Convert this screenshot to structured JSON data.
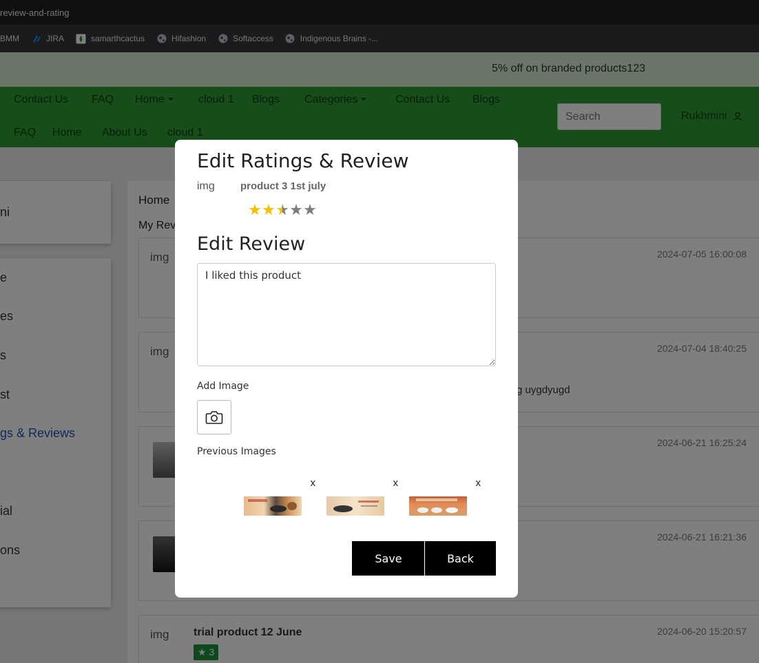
{
  "browser": {
    "tab_title": "review-and-rating",
    "bookmarks": [
      {
        "label": "BMM",
        "icon": "none"
      },
      {
        "label": "JIRA",
        "icon": "jira-icon"
      },
      {
        "label": "samarthcactus",
        "icon": "cactus-icon"
      },
      {
        "label": "Hifashion",
        "icon": "globe-icon"
      },
      {
        "label": "Softaccess",
        "icon": "globe-icon"
      },
      {
        "label": "Indigenous Brains -...",
        "icon": "globe-icon"
      }
    ]
  },
  "promo": {
    "text": "5% off on branded products123"
  },
  "navbar": {
    "row1": [
      "Contact Us",
      "FAQ",
      "Home",
      "cloud 1",
      "Blogs",
      "Categories",
      "Contact Us",
      "Blogs"
    ],
    "row2": [
      "FAQ",
      "Home",
      "About Us",
      "cloud 1"
    ],
    "search_placeholder": "Search",
    "user_name": "Rukhmini"
  },
  "sidebar": {
    "profile_name": "ni",
    "items": [
      "e",
      "es",
      "s",
      "st",
      "gs & Reviews",
      "ial",
      "ons"
    ],
    "active_index": 4
  },
  "main": {
    "breadcrumb": "Home",
    "heading": "My Rev",
    "reviews": [
      {
        "img_alt": "img",
        "date": "2024-07-05 16:00:08",
        "title": "",
        "text": ""
      },
      {
        "img_alt": "img",
        "date": "2024-07-04 18:40:25",
        "title": "",
        "text": "g uygdyugd"
      },
      {
        "img_alt": "",
        "date": "2024-06-21 16:25:24",
        "title": "",
        "text": ""
      },
      {
        "img_alt": "",
        "date": "2024-06-21 16:21:36",
        "title": "",
        "text": ""
      },
      {
        "img_alt": "img",
        "date": "2024-06-20 15:20:57",
        "title": "trial product 12 June",
        "text": "",
        "rating": "3"
      }
    ]
  },
  "modal": {
    "title": "Edit Ratings & Review",
    "img_alt": "img",
    "product_name": "product 3 1st july",
    "rating": 2.5,
    "max_rating": 5,
    "edit_review_heading": "Edit Review",
    "review_text": "I liked this product",
    "add_image_label": "Add Image",
    "previous_images_label": "Previous Images",
    "previous_images": [
      {
        "remove_label": "x",
        "alt": "cookware banner 1"
      },
      {
        "remove_label": "x",
        "alt": "cookware banner 2"
      },
      {
        "remove_label": "x",
        "alt": "cookware banner 3"
      }
    ],
    "save_label": "Save",
    "back_label": "Back"
  },
  "colors": {
    "navbar": "#2f9a36",
    "promo": "#d3ecd0",
    "button": "#000000",
    "star_full": "#f2c200",
    "star_empty": "#7d7d7d",
    "active_sidebar": "#1f57b5"
  }
}
